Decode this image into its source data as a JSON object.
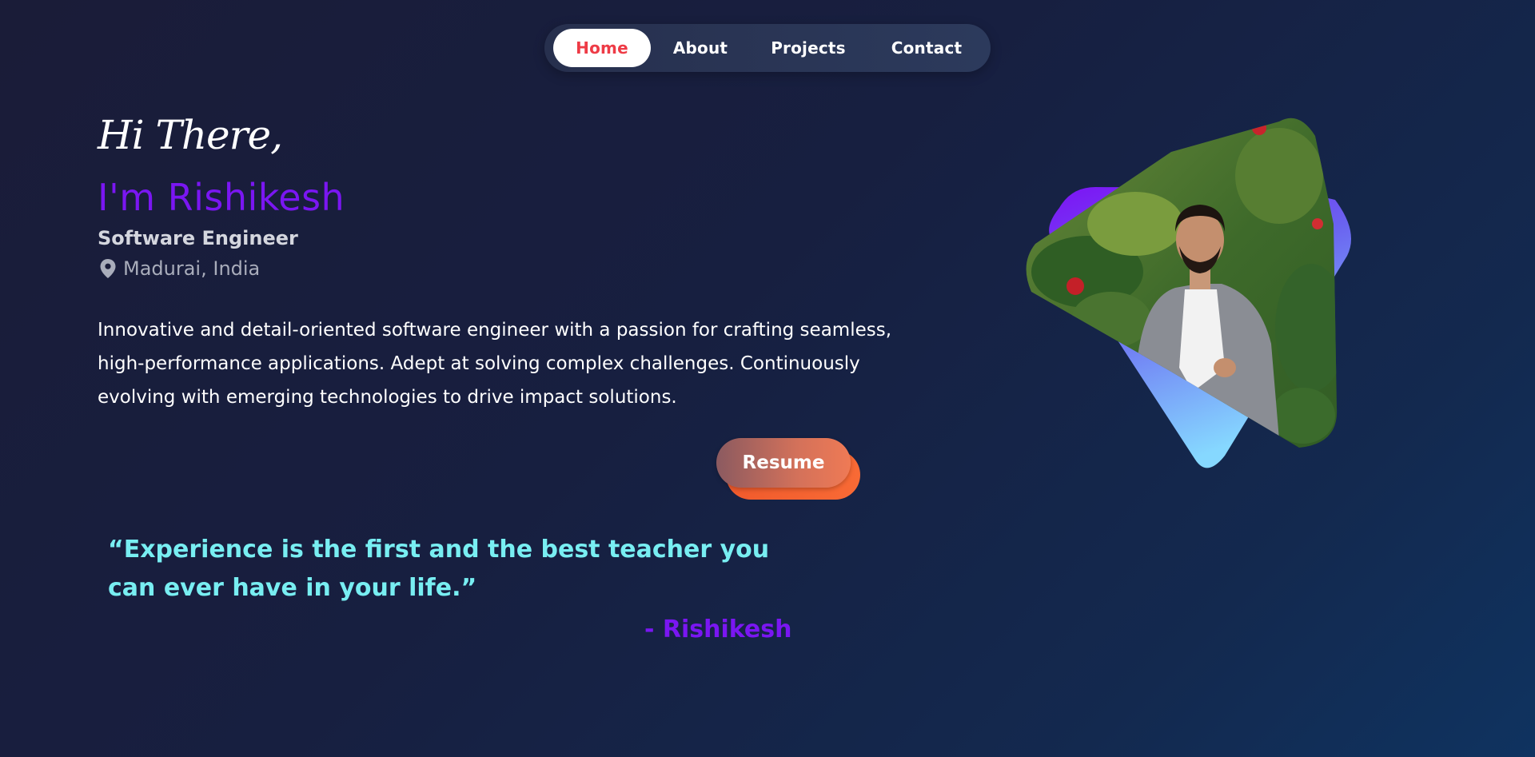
{
  "nav": {
    "items": [
      {
        "label": "Home",
        "active": true
      },
      {
        "label": "About",
        "active": false
      },
      {
        "label": "Projects",
        "active": false
      },
      {
        "label": "Contact",
        "active": false
      }
    ]
  },
  "hero": {
    "greeting": "Hi There,",
    "name": "I'm Rishikesh",
    "role": "Software Engineer",
    "location": "Madurai, India",
    "location_icon": "map-pin-icon",
    "bio": "Innovative and detail-oriented software engineer with a passion for crafting seamless, high-performance applications. Adept at solving complex challenges. Continuously evolving with emerging technologies to drive impact solutions.",
    "resume_label": "Resume"
  },
  "quote": {
    "text": "“Experience is the first and the best teacher you can ever have in your life.”",
    "author": "- Rishikesh"
  },
  "colors": {
    "accent_purple": "#7a16f2",
    "nav_active_text": "#ee3b46",
    "quote_cyan": "#78eef2",
    "resume_orange": "#f05a2c"
  }
}
